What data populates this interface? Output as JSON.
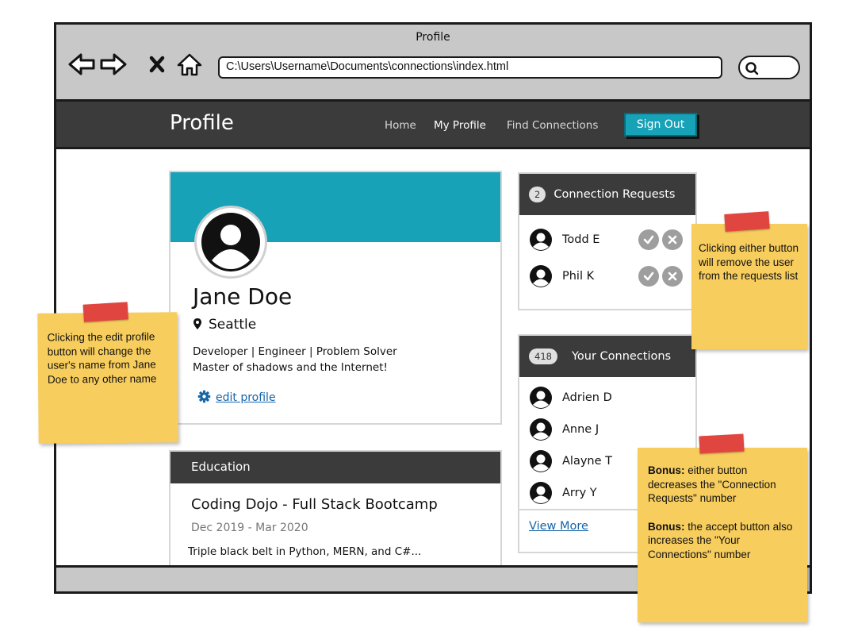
{
  "browser": {
    "window_title": "Profile",
    "address": "C:\\Users\\Username\\Documents\\connections\\index.html",
    "icons": [
      "back-arrow-icon",
      "forward-arrow-icon",
      "close-icon",
      "home-icon",
      "search-icon"
    ]
  },
  "nav": {
    "brand": "Profile",
    "links": [
      "Home",
      "My Profile",
      "Find Connections"
    ],
    "active": "My Profile",
    "signout_label": "Sign Out"
  },
  "profile": {
    "name": "Jane Doe",
    "location": "Seattle",
    "bio_line1": "Developer | Engineer | Problem Solver",
    "bio_line2": "Master of shadows and the Internet!",
    "edit_label": "edit profile"
  },
  "education": {
    "header": "Education",
    "school": "Coding Dojo - Full Stack Bootcamp",
    "dates": "Dec 2019 - Mar 2020",
    "description": "Triple black belt in Python, MERN, and C#..."
  },
  "requests": {
    "count": "2",
    "title": "Connection Requests",
    "users": [
      "Todd E",
      "Phil K"
    ]
  },
  "connections": {
    "count": "418",
    "title": "Your Connections",
    "users": [
      "Adrien D",
      "Anne J",
      "Alayne T",
      "Arry Y"
    ],
    "view_more": "View More"
  },
  "notes": {
    "edit_note": "Clicking the edit profile button will change the user's name from Jane Doe to any other name",
    "requests_note": "Clicking either button will remove the user from the requests list",
    "bonus_label": "Bonus:",
    "bonus1": "either button decreases the \"Connection Requests\" number",
    "bonus2": "the accept button also increases the \"Your Connections\" number"
  },
  "colors": {
    "accent": "#17a2b8",
    "nav_bg": "#3b3b3b",
    "sticky": "#f7cd5e",
    "tape": "#e0463f",
    "link": "#1565a8"
  }
}
